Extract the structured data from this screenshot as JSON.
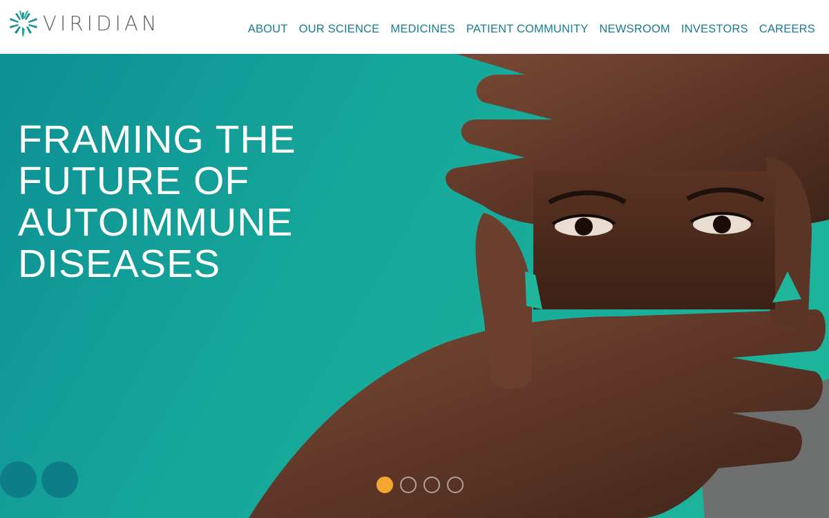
{
  "brand": {
    "name": "VIRIDIAN",
    "logo_icon": "viridian-star-icon"
  },
  "nav": {
    "items": [
      {
        "label": "ABOUT"
      },
      {
        "label": "OUR SCIENCE"
      },
      {
        "label": "MEDICINES"
      },
      {
        "label": "PATIENT COMMUNITY"
      },
      {
        "label": "NEWSROOM"
      },
      {
        "label": "INVESTORS"
      },
      {
        "label": "CAREERS"
      }
    ]
  },
  "hero": {
    "title_lines": [
      "FRAMING THE",
      "FUTURE OF",
      "AUTOIMMUNE",
      "DISEASES"
    ],
    "slides_total": 4,
    "active_slide": 1
  },
  "colors": {
    "nav_text": "#177d8c",
    "logo_text": "#5d6266",
    "hero_teal": "#16a79a",
    "active_dot": "#f5a630",
    "control_circle": "#0d7e88"
  }
}
